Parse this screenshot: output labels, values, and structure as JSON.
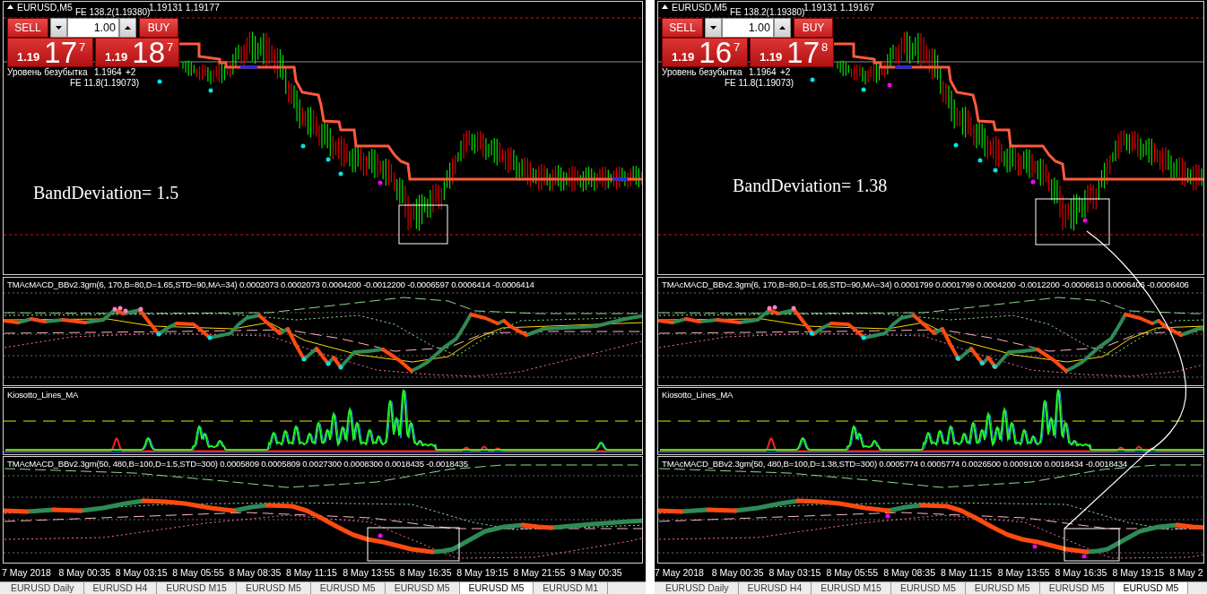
{
  "panels": [
    {
      "symbol": "EURUSD,M5",
      "quote": "1.19131 1.19177",
      "fibo_upper": "FE 138.2(1.19380)",
      "trade_panel": {
        "sell_label": "SELL",
        "lot": "1.00",
        "buy_label": "BUY",
        "sell_quote": {
          "base": "1.19",
          "pips": "17",
          "point": "7"
        },
        "buy_quote": {
          "base": "1.19",
          "pips": "18",
          "point": "7"
        }
      },
      "breakeven": {
        "label": "Уровень безубытка",
        "price": "1.1964",
        "points": "+2"
      },
      "fibo_lower": "FE 11.8(1.19073)",
      "annotation": "BandDeviation= 1.5",
      "indicators": [
        {
          "kind": "tma_fast",
          "label": "TMAcMACD_BBv2.3gm(6, 170,B=80,D=1.65,STD=90,MA=34) 0.0002073 0.0002073 0.0004200 -0.0012200 -0.0006597 0.0006414 -0.0006414"
        },
        {
          "kind": "kiosotto",
          "label": "Kiosotto_Lines_MA"
        },
        {
          "kind": "tma_slow",
          "label": "TMAcMACD_BBv2.3gm(50, 480,B=100,D=1.5,STD=300) 0.0005809 0.0005809 0.0027300 0.0008300 0.0018435 -0.0018435"
        }
      ],
      "time_axis": [
        "7 May 2018",
        "8 May 00:35",
        "8 May 03:15",
        "8 May 05:55",
        "8 May 08:35",
        "8 May 11:15",
        "8 May 13:55",
        "8 May 16:35",
        "8 May 19:15",
        "8 May 21:55",
        "9 May 00:35"
      ],
      "tabs": [
        {
          "label": "EURUSD Daily",
          "selected": false
        },
        {
          "label": "EURUSD H4",
          "selected": false
        },
        {
          "label": "EURUSD M15",
          "selected": false
        },
        {
          "label": "EURUSD M5",
          "selected": false
        },
        {
          "label": "EURUSD M5",
          "selected": false
        },
        {
          "label": "EURUSD M5",
          "selected": false
        },
        {
          "label": "EURUSD M5",
          "selected": true
        },
        {
          "label": "EURUSD M1",
          "selected": false
        }
      ]
    },
    {
      "symbol": "EURUSD,M5",
      "quote": "1.19131 1.19167",
      "fibo_upper": "FE 138.2(1.19380)",
      "trade_panel": {
        "sell_label": "SELL",
        "lot": "1.00",
        "buy_label": "BUY",
        "sell_quote": {
          "base": "1.19",
          "pips": "16",
          "point": "7"
        },
        "buy_quote": {
          "base": "1.19",
          "pips": "17",
          "point": "8"
        }
      },
      "breakeven": {
        "label": "Уровень безубытка",
        "price": "1.1964",
        "points": "+2"
      },
      "fibo_lower": "FE 11.8(1.19073)",
      "annotation": "BandDeviation= 1.38",
      "indicators": [
        {
          "kind": "tma_fast",
          "label": "TMAcMACD_BBv2.3gm(6, 170,B=80,D=1.65,STD=90,MA=34) 0.0001799 0.0001799 0.0004200 -0.0012200 -0.0006613 0.0006406 -0.0006406"
        },
        {
          "kind": "kiosotto",
          "label": "Kiosotto_Lines_MA"
        },
        {
          "kind": "tma_slow",
          "label": "TMAcMACD_BBv2.3gm(50, 480,B=100,D=1.38,STD=300) 0.0005774 0.0005774 0.0026500 0.0009100 0.0018434 -0.0018434"
        }
      ],
      "time_axis": [
        "7 May 2018",
        "8 May 00:35",
        "8 May 03:15",
        "8 May 05:55",
        "8 May 08:35",
        "8 May 11:15",
        "8 May 13:55",
        "8 May 16:35",
        "8 May 19:15",
        "8 May 2"
      ],
      "tabs": [
        {
          "label": "EURUSD Daily",
          "selected": false
        },
        {
          "label": "EURUSD H4",
          "selected": false
        },
        {
          "label": "EURUSD M15",
          "selected": false
        },
        {
          "label": "EURUSD M5",
          "selected": false
        },
        {
          "label": "EURUSD M5",
          "selected": false
        },
        {
          "label": "EURUSD M5",
          "selected": false
        },
        {
          "label": "EURUSD M5",
          "selected": true
        }
      ]
    }
  ]
}
